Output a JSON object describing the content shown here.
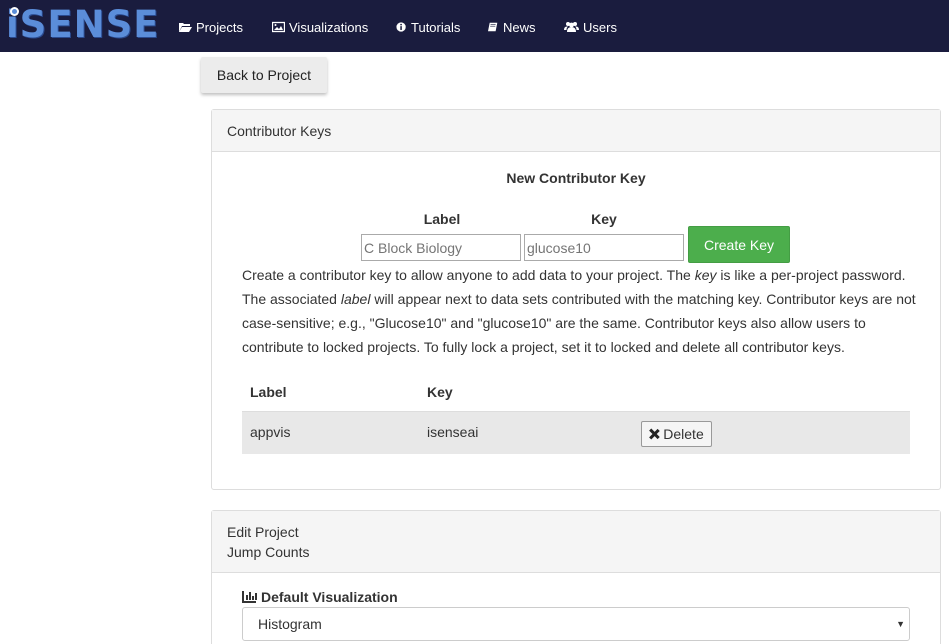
{
  "nav": {
    "logo": "iSENSE",
    "items": [
      {
        "label": "Projects",
        "icon": "folder-open-icon"
      },
      {
        "label": "Visualizations",
        "icon": "image-icon"
      },
      {
        "label": "Tutorials",
        "icon": "info-circle-icon"
      },
      {
        "label": "News",
        "icon": "book-icon"
      },
      {
        "label": "Users",
        "icon": "users-icon"
      }
    ]
  },
  "back_button": "Back to Project",
  "contributor_keys": {
    "heading": "Contributor Keys",
    "form_title": "New Contributor Key",
    "label_header": "Label",
    "key_header": "Key",
    "label_placeholder": "C Block Biology",
    "key_placeholder": "glucose10",
    "create_button": "Create Key",
    "description": {
      "p1": "Create a contributor key to allow anyone to add data to your project. The ",
      "em1": "key",
      "p2": " is like a per-project password. The associated ",
      "em2": "label",
      "p3": " will appear next to data sets contributed with the matching key. Contributor keys are not case-sensitive; e.g., \"Glucose10\" and \"glucose10\" are the same. Contributor keys also allow users to contribute to locked projects. To fully lock a project, set it to locked and delete all contributor keys."
    },
    "table": {
      "headers": [
        "Label",
        "Key"
      ],
      "rows": [
        {
          "label": "appvis",
          "key": "isenseai",
          "action": "Delete"
        }
      ]
    }
  },
  "edit_project": {
    "heading_line1": "Edit Project",
    "heading_line2": "Jump Counts",
    "default_viz_label": "Default Visualization",
    "default_viz_value": "Histogram"
  },
  "colors": {
    "navbar": "#1a1c3e",
    "create_button": "#4cae4c"
  }
}
